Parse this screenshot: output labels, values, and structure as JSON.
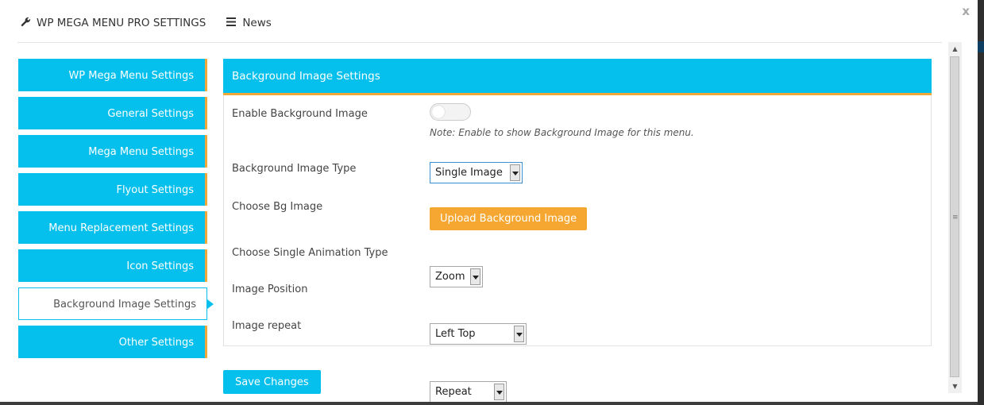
{
  "header": {
    "title": "WP MEGA MENU PRO SETTINGS",
    "title_icon": "wrench-icon",
    "news_label": "News",
    "news_icon": "hamburger-icon",
    "close_label": "x"
  },
  "sidebar": {
    "items": [
      {
        "label": "WP Mega Menu Settings"
      },
      {
        "label": "General Settings"
      },
      {
        "label": "Mega Menu Settings"
      },
      {
        "label": "Flyout Settings"
      },
      {
        "label": "Menu Replacement Settings"
      },
      {
        "label": "Icon Settings"
      },
      {
        "label": "Background Image Settings",
        "active": true
      },
      {
        "label": "Other Settings"
      }
    ]
  },
  "panel": {
    "title": "Background Image Settings",
    "enable_bg": {
      "label": "Enable Background Image",
      "enabled": false,
      "note": "Note: Enable to show Background Image for this menu."
    },
    "bg_type": {
      "label": "Background Image Type",
      "value": "Single Image"
    },
    "choose_bg": {
      "label": "Choose Bg Image",
      "button": "Upload Background Image"
    },
    "animation": {
      "label": "Choose Single Animation Type",
      "value": "Zoom"
    },
    "position": {
      "label": "Image Position",
      "value": "Left Top"
    },
    "repeat": {
      "label": "Image repeat",
      "value": "Repeat"
    }
  },
  "save_button": "Save Changes",
  "colors": {
    "accent_blue": "#05bfec",
    "accent_orange": "#f5a731"
  }
}
